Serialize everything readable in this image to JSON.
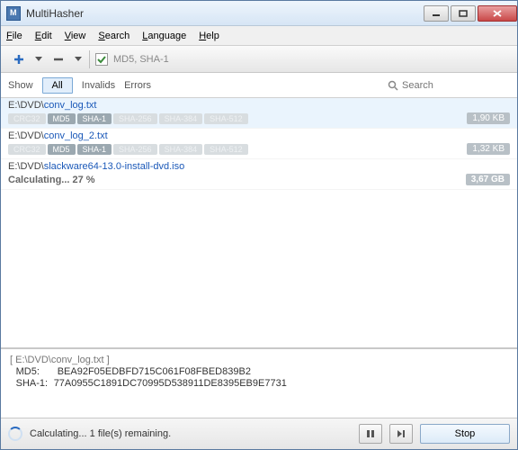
{
  "title": "MultiHasher",
  "menu": {
    "file": "File",
    "edit": "Edit",
    "view": "View",
    "search": "Search",
    "language": "Language",
    "help": "Help"
  },
  "toolbar": {
    "algo_label": "MD5, SHA-1"
  },
  "filter": {
    "show": "Show",
    "all": "All",
    "invalids": "Invalids",
    "errors": "Errors",
    "search_placeholder": "Search"
  },
  "all_tag_names": {
    "crc32": "CRC32",
    "md5": "MD5",
    "sha1": "SHA-1",
    "sha256": "SHA-256",
    "sha384": "SHA-384",
    "sha512": "SHA-512"
  },
  "files": {
    "r0": {
      "prefix": "E:\\DVD\\",
      "name": "conv_log.txt",
      "size": "1,90 KB"
    },
    "r1": {
      "prefix": "E:\\DVD\\",
      "name": "conv_log_2.txt",
      "size": "1,32 KB"
    },
    "r2": {
      "prefix": "E:\\DVD\\",
      "name": "slackware64-13.0-install-dvd.iso",
      "size": "3,67 GB",
      "calc": "Calculating... 27 %"
    }
  },
  "details": {
    "header": "[ E:\\DVD\\conv_log.txt ]",
    "md5_label": "MD5:",
    "md5": "BEA92F05EDBFD715C061F08FBED839B2",
    "sha1_label": "SHA-1:",
    "sha1": "77A0955C1891DC70995D538911DE8395EB9E7731"
  },
  "status": {
    "text": "Calculating... 1 file(s) remaining.",
    "stop": "Stop"
  }
}
